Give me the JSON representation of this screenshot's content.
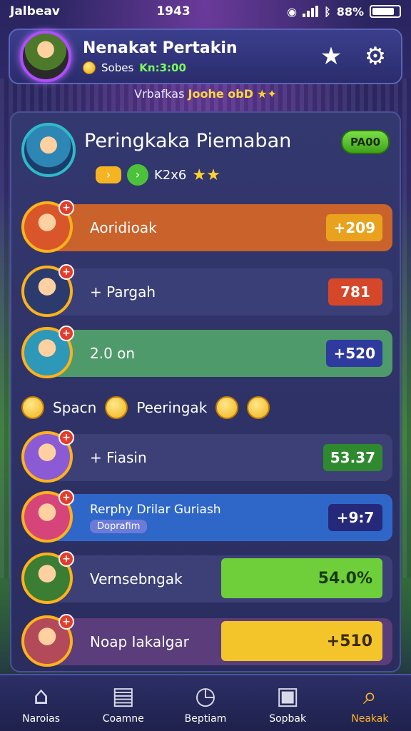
{
  "status": {
    "left": "Jalbeav",
    "time": "1943",
    "battery_pct": "88%"
  },
  "header": {
    "name": "Nenakat Pertakin",
    "sub_label": "Sobes",
    "sub_value": "Kn:3:00",
    "star_icon": "star-icon",
    "settings_icon": "gear-icon"
  },
  "subtitle": {
    "text": "Vrbafkas",
    "highlight": "Joohe obD"
  },
  "panel": {
    "title": "Peringkaka Piemaban",
    "badge": "PA00",
    "meta_text": "K2x6"
  },
  "rows": [
    {
      "label": "Aoridioak",
      "score": "+209",
      "avatar_color": "#d9562a",
      "bar": "#c9622b",
      "score_bg": "#e8a21e"
    },
    {
      "label": "+ Pargah",
      "score": "781",
      "avatar_color": "#2c3b6e",
      "bar": "#3b3f77",
      "score_bg": "#d6472a"
    },
    {
      "label": "2.0 on",
      "score": "+520",
      "avatar_color": "#2d98b8",
      "bar": "#4f9a6a",
      "score_bg": "#2f3a9e"
    },
    {
      "label": "+ Fiasin",
      "score": "53.37",
      "avatar_color": "#8b5bd6",
      "bar": "#3d4077",
      "score_bg": "#2f8a2f"
    },
    {
      "label": "Rerphy Drilar Guriash",
      "sublabel": "Doprafim",
      "score": "+9:7",
      "avatar_color": "#d6457a",
      "bar": "#2f67c9",
      "score_bg": "#26297a"
    },
    {
      "label": "Vernsebngak",
      "score": "54.0%",
      "avatar_color": "#3c7d34",
      "bar": "#3d4077",
      "score_bg": "#6fcf3a"
    },
    {
      "label": "Noap Iakalgar",
      "score": "+510",
      "avatar_color": "#b24a5a",
      "bar": "#5a3d7a",
      "score_bg": "#f4c52b"
    }
  ],
  "divider": {
    "left": "Spacn",
    "right": "Peeringak"
  },
  "nav": [
    {
      "label": "Naroias",
      "icon": "home-icon",
      "glyph": "⌂"
    },
    {
      "label": "Coamne",
      "icon": "cards-icon",
      "glyph": "▤"
    },
    {
      "label": "Beptiam",
      "icon": "clock-icon",
      "glyph": "◷"
    },
    {
      "label": "Sopbak",
      "icon": "shop-icon",
      "glyph": "▣"
    },
    {
      "label": "Neakak",
      "icon": "search-icon",
      "glyph": "⌕"
    }
  ]
}
